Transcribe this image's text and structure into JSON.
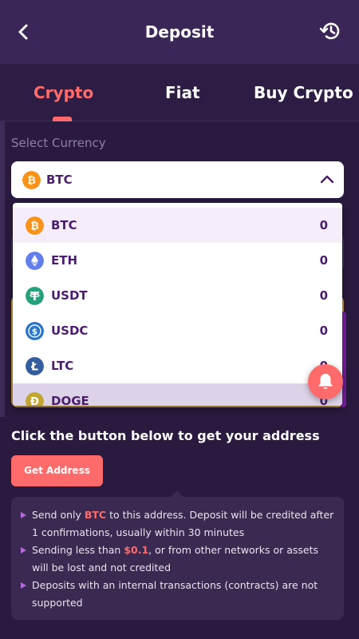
{
  "header": {
    "title": "Deposit",
    "back_icon": "chevron-left-icon",
    "history_icon": "history-icon"
  },
  "tabs": [
    {
      "label": "Crypto",
      "active": true
    },
    {
      "label": "Fiat",
      "active": false
    },
    {
      "label": "Buy Crypto",
      "active": false
    }
  ],
  "currency_select": {
    "label": "Select Currency",
    "selected": "BTC",
    "expanded": true
  },
  "currencies": [
    {
      "symbol": "BTC",
      "amount": "0",
      "icon": "bitcoin-icon",
      "color": "#f7931a",
      "glyph": "₿"
    },
    {
      "symbol": "ETH",
      "amount": "0",
      "icon": "ethereum-icon",
      "color": "#627eea",
      "glyph": "◆"
    },
    {
      "symbol": "USDT",
      "amount": "0",
      "icon": "tether-icon",
      "color": "#26a17b",
      "glyph": "₮"
    },
    {
      "symbol": "USDC",
      "amount": "0",
      "icon": "usdc-icon",
      "color": "#2775ca",
      "glyph": "$"
    },
    {
      "symbol": "LTC",
      "amount": "0",
      "icon": "litecoin-icon",
      "color": "#345d9d",
      "glyph": "Ł"
    },
    {
      "symbol": "DOGE",
      "amount": "0",
      "icon": "dogecoin-icon",
      "color": "#c2a633",
      "glyph": "Ð"
    }
  ],
  "cta": {
    "text": "Click the button below to get your address",
    "button_label": "Get Address"
  },
  "notes": {
    "n1_pre": "Send only ",
    "n1_hl": "BTC",
    "n1_post": " to this address. Deposit will be credited after 1 confirmations, usually within 30 minutes",
    "n2_pre": "Sending less than ",
    "n2_hl": "$0.1",
    "n2_post": ", or from other networks or assets will be lost and not credited",
    "n3": "Deposits with an internal transactions (contracts) are not supported"
  },
  "colors": {
    "accent": "#ff6b6b",
    "header_bg": "#3a2657",
    "page_bg": "#2a1a3f",
    "text_purple": "#4b1d6e"
  },
  "bell_icon": "bell-icon"
}
